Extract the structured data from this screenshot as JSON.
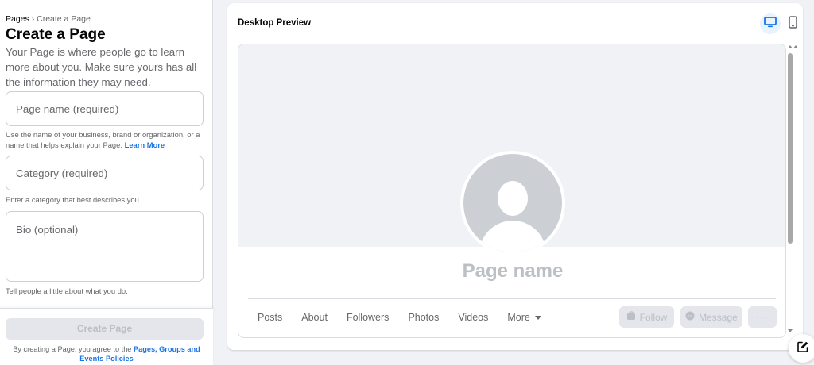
{
  "sidebar": {
    "breadcrumb": {
      "root": "Pages",
      "separator": "›",
      "current": "Create a Page"
    },
    "title": "Create a Page",
    "intro": "Your Page is where people go to learn more about you. Make sure yours has all the information they may need.",
    "fields": {
      "name": {
        "placeholder": "Page name (required)",
        "help": "Use the name of your business, brand or organization, or a name that helps explain your Page.",
        "help_link": "Learn More"
      },
      "category": {
        "placeholder": "Category (required)",
        "help": "Enter a category that best describes you."
      },
      "bio": {
        "placeholder": "Bio (optional)",
        "help": "Tell people a little about what you do."
      }
    },
    "create_button": "Create Page",
    "terms_prefix": "By creating a Page, you agree to the",
    "terms_link": "Pages, Groups and Events Policies"
  },
  "preview": {
    "title": "Desktop Preview",
    "icons": {
      "desktop": "desktop-icon",
      "mobile": "mobile-icon"
    },
    "page_name": "Page name",
    "tabs": [
      "Posts",
      "About",
      "Followers",
      "Photos",
      "Videos"
    ],
    "more_tab": "More",
    "actions": {
      "follow": "Follow",
      "message": "Message",
      "more": "···"
    }
  },
  "colors": {
    "accent": "#1b74e4",
    "background": "#f0f2f5",
    "disabled": "#bcc0c4"
  }
}
